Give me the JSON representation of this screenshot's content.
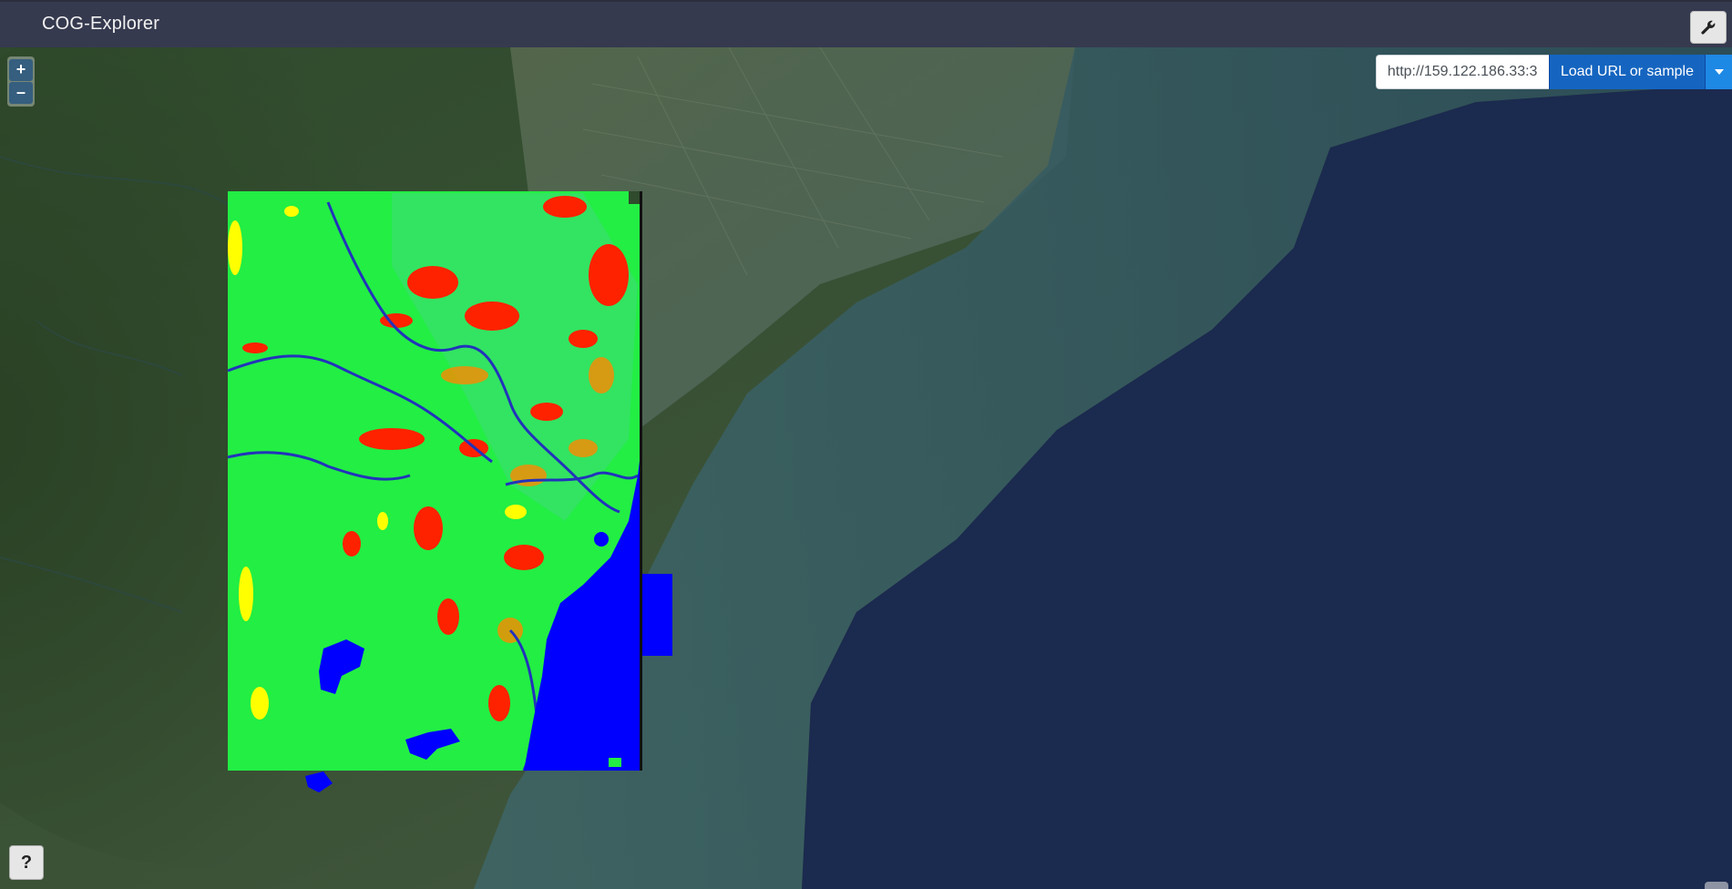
{
  "app": {
    "title": "COG-Explorer"
  },
  "toolbar": {
    "settings_icon": "wrench-icon"
  },
  "zoom": {
    "in_label": "+",
    "out_label": "–"
  },
  "loader": {
    "url_value": "http://159.122.186.33:3",
    "load_label": "Load URL or sample",
    "dropdown_icon": "caret-down-icon"
  },
  "help": {
    "label": "?"
  },
  "colors": {
    "navbar": "#363a4f",
    "load_button": "#1565c0",
    "dropdown_button": "#1e88e5",
    "ocean": "#1b2a4f",
    "raster_vegetation": "#22ee44",
    "raster_water": "#0000ff",
    "raster_red": "#ff2200",
    "raster_yellow": "#ffff00"
  },
  "map": {
    "basemap": "satellite imagery",
    "overlay": "classified COG raster"
  }
}
